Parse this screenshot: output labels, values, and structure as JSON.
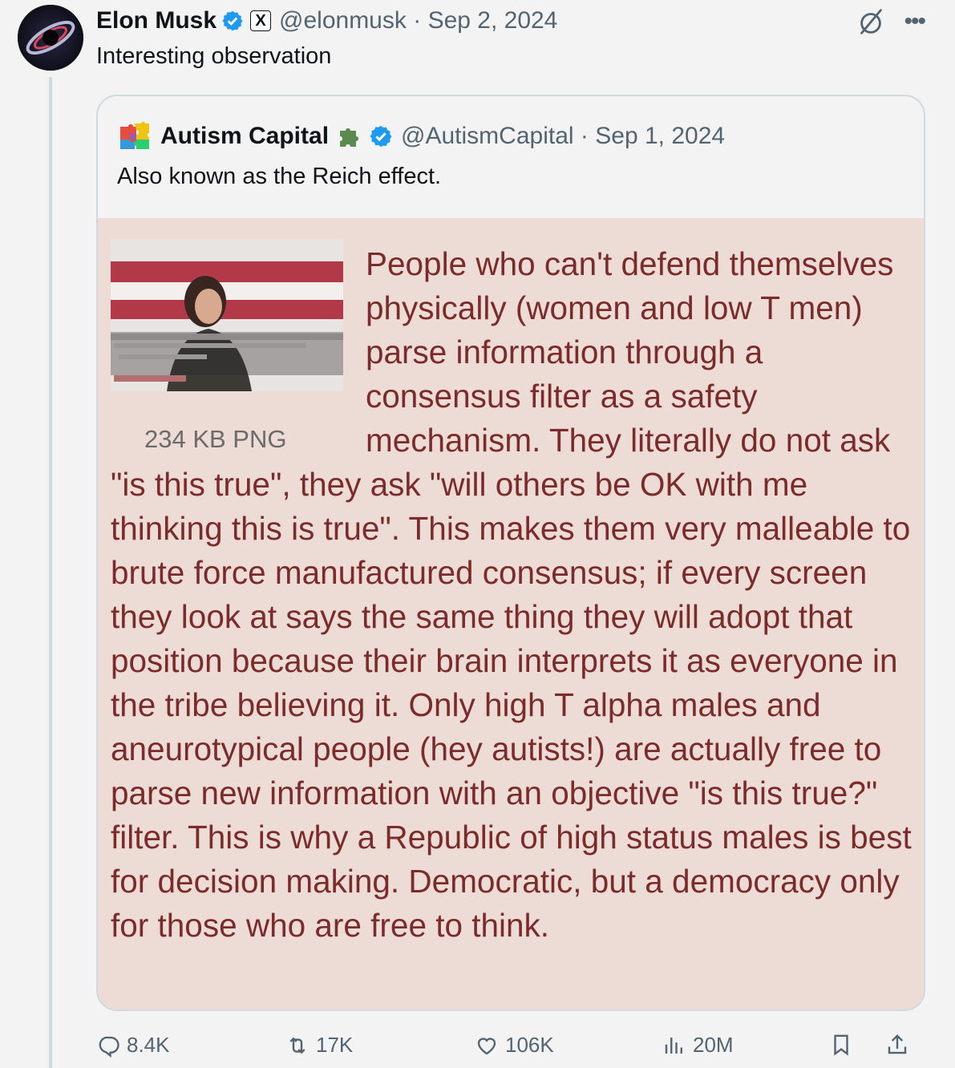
{
  "author": {
    "name": "Elon Musk",
    "handle": "@elonmusk",
    "date": "Sep 2, 2024",
    "separator": "·",
    "x_badge": "X"
  },
  "tweet": {
    "text": "Interesting observation"
  },
  "quote": {
    "name": "Autism Capital",
    "handle": "@AutismCapital",
    "date": "Sep 1, 2024",
    "separator": "·",
    "text": "Also known as the Reich effect.",
    "image": {
      "caption": "234 KB PNG",
      "body": "People who can't defend themselves physically (women and low T men) parse information through a consensus filter as a safety mechanism. They literally do not ask \"is this true\", they ask \"will others be OK with me thinking this is true\". This makes them very malleable to brute force manufactured consensus; if every screen they look at says the same thing they will adopt that position because their brain interprets it as everyone in the tribe believing it. Only high T alpha males and aneurotypical people (hey autists!) are actually free to parse new information with an objective \"is this true?\" filter. This is why a Republic of high status males is best for decision making. Democratic, but a democracy only for those who are free to think."
    }
  },
  "actions": {
    "replies": "8.4K",
    "reposts": "17K",
    "likes": "106K",
    "views": "20M"
  },
  "colors": {
    "verified": "#1d9bf0",
    "muted": "#536471",
    "border": "#cfd9de",
    "image_bg": "#ecdcd5",
    "image_text": "#7c2b2b"
  },
  "icons": [
    "grok-icon",
    "more-icon",
    "reply-icon",
    "repost-icon",
    "like-icon",
    "views-icon",
    "bookmark-icon",
    "share-icon"
  ]
}
